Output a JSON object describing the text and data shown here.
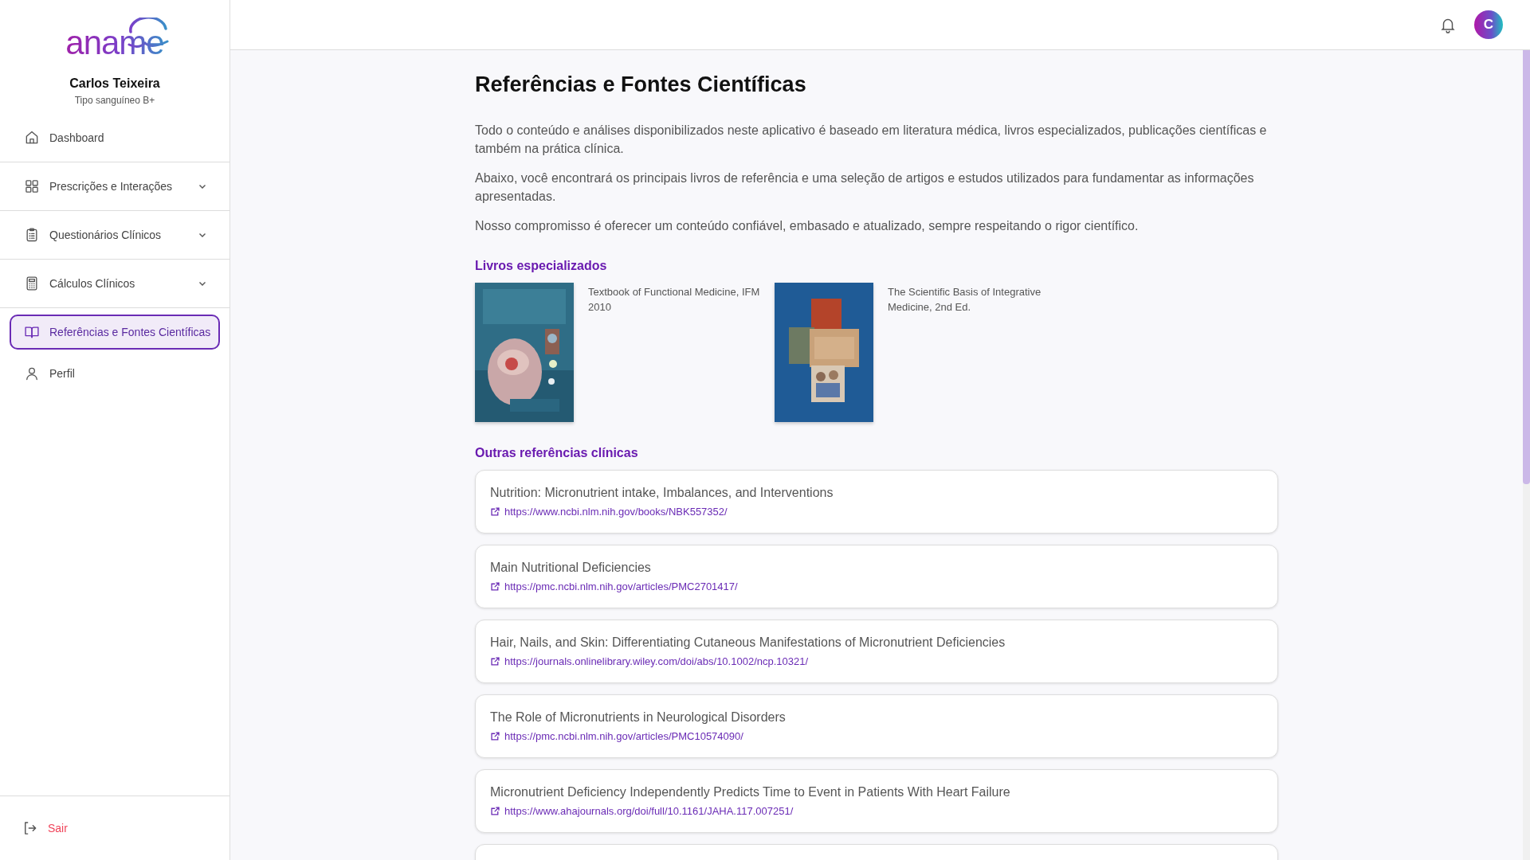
{
  "sidebar": {
    "logo": "aname",
    "user": {
      "name": "Carlos Teixeira",
      "subtitle": "Tipo sanguíneo B+"
    },
    "items": [
      {
        "label": "Dashboard",
        "selected": false
      },
      {
        "label": "Prescrições e Interações",
        "selected": false,
        "expanded": false
      },
      {
        "label": "Questionários Clínicos",
        "selected": false,
        "expanded": false
      },
      {
        "label": "Cálculos Clínicos",
        "selected": false,
        "expanded": false
      },
      {
        "label": "Referências e Fontes Científicas",
        "selected": true
      },
      {
        "label": "Perfil",
        "selected": false
      }
    ],
    "logout": "Sair"
  },
  "topbar": {
    "avatar": "C"
  },
  "page": {
    "title": "Referências e Fontes Científicas",
    "paragraphs": [
      "Todo o conteúdo e análises disponibilizados neste aplicativo é baseado em literatura médica, livros especializados, publicações científicas e também na prática clínica.",
      "Abaixo, você encontrará os principais livros de referência e uma seleção de artigos e estudos utilizados para fundamentar as informações apresentadas.",
      "Nosso compromisso é oferecer um conteúdo confiável, embasado e atualizado, sempre respeitando o rigor científico."
    ],
    "books_heading": "Livros especializados",
    "books": [
      {
        "kind": "picture",
        "caption": "Textbook of Functional Medicine, IFM 2010"
      },
      {
        "kind": "picture",
        "caption": "The Scientific Basis of Integrative Medicine, 2nd Ed."
      }
    ],
    "references_heading": "Outras referências clínicas",
    "references": [
      {
        "title": "Nutrition: Micronutrient intake, Imbalances, and Interventions",
        "url": "https://www.ncbi.nlm.nih.gov/books/NBK557352/"
      },
      {
        "title": "Main Nutritional Deficiencies",
        "url": "https://pmc.ncbi.nlm.nih.gov/articles/PMC2701417/"
      },
      {
        "title": "Hair, Nails, and Skin: Differentiating Cutaneous Manifestations of Micronutrient Deficiencies",
        "url": "https://journals.onlinelibrary.wiley.com/doi/abs/10.1002/ncp.10321/"
      },
      {
        "title": "The Role of Micronutrients in Neurological Disorders",
        "url": "https://pmc.ncbi.nlm.nih.gov/articles/PMC10574090/"
      },
      {
        "title": "Micronutrient Deficiency Independently Predicts Time to Event in Patients With Heart Failure",
        "url": "https://www.ahajournals.org/doi/full/10.1161/JAHA.117.007251/"
      }
    ]
  }
}
